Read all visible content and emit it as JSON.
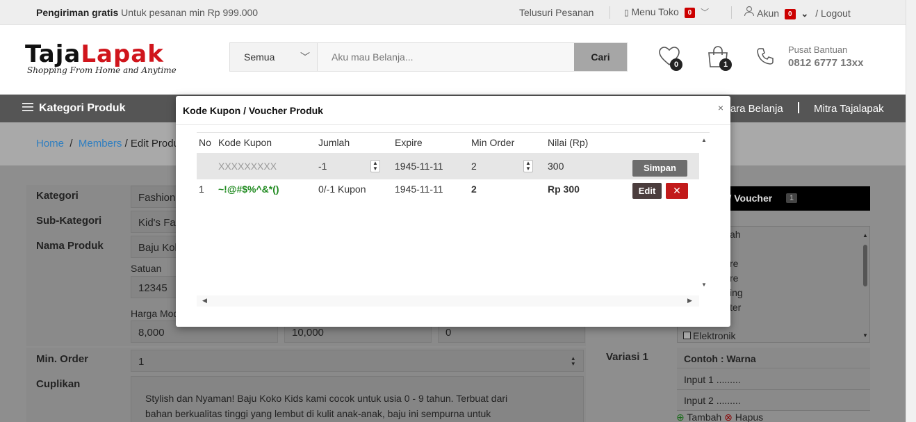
{
  "topbar": {
    "shipping_bold": "Pengiriman gratis",
    "shipping_text": "Untuk pesanan min Rp 999.000",
    "track_orders": "Telusuri Pesanan",
    "store_menu": "Menu Toko",
    "store_badge": "0",
    "account": "Akun",
    "account_badge": "0",
    "logout": "/ Logout"
  },
  "header": {
    "logo_black": "Taja",
    "logo_red": "Lapak",
    "logo_tagline": "Shopping From Home and Anytime",
    "search_category": "Semua",
    "search_placeholder": "Aku mau Belanja...",
    "search_button": "Cari",
    "wishlist_count": "0",
    "cart_count": "1",
    "help_label": "Pusat Bantuan",
    "help_phone": "0812 6777 13xx"
  },
  "nav": {
    "categories": "Kategori Produk",
    "how_to_shop": "Cara Belanja",
    "partner": "Mitra Tajalapak"
  },
  "breadcrumb": {
    "home": "Home",
    "members": "Members",
    "current": "/ Edit Produk"
  },
  "form": {
    "kategori_label": "Kategori",
    "kategori_value": "Fashion",
    "subkategori_label": "Sub-Kategori",
    "subkategori_value": "Kid's Fashion",
    "nama_label": "Nama Produk",
    "nama_value": "Baju Koko",
    "satuan_label": "Satuan",
    "satuan_value": "12345",
    "harga_label": "Harga Modal",
    "harga_modal": "8,000",
    "harga_jual": "10,000",
    "harga_diskon": "0",
    "minorder_label": "Min. Order",
    "minorder_value": "1",
    "cuplikan_label": "Cuplikan",
    "cuplikan_line1": "Stylish dan Nyaman! Baju Koko Kids kami cocok untuk usia 0 - 9 tahun. Terbuat dari",
    "cuplikan_line2": "bahan berkualitas tinggi yang lembut di kulit anak-anak, baju ini sempurna untuk",
    "variasi_label": "Variasi 1",
    "variasi_example": "Contoh : Warna",
    "input1": "Input 1 .........",
    "input2": "Input 2 .........",
    "tambah": "Tambah",
    "hapus": "Hapus"
  },
  "side_panel": {
    "voucher_title": "n / Voucher",
    "voucher_count": "1",
    "list_items": [
      "ah",
      "re",
      "re",
      "ing",
      "ter"
    ],
    "elektronik": "Elektronik"
  },
  "modal": {
    "title": "Kode Kupon / Voucher Produk",
    "close": "×",
    "columns": [
      "No",
      "Kode Kupon",
      "Jumlah",
      "Expire",
      "Min Order",
      "Nilai (Rp)"
    ],
    "new_row": {
      "code_placeholder": "XXXXXXXXX",
      "jumlah": "-1",
      "expire": "1945-11-11",
      "min_order": "2",
      "nilai": "300",
      "save": "Simpan"
    },
    "rows": [
      {
        "no": "1",
        "code": "~!@#$%^&*()",
        "jumlah": "0/-1 Kupon",
        "expire": "1945-11-11",
        "min_order": "2",
        "nilai": "Rp 300",
        "edit": "Edit",
        "delete": "✕"
      }
    ]
  },
  "colors": {
    "brand_red": "#d0151c",
    "coupon_green": "#1f8a1f",
    "badge_red": "#cc0000",
    "delete_red": "#c21a1a"
  }
}
